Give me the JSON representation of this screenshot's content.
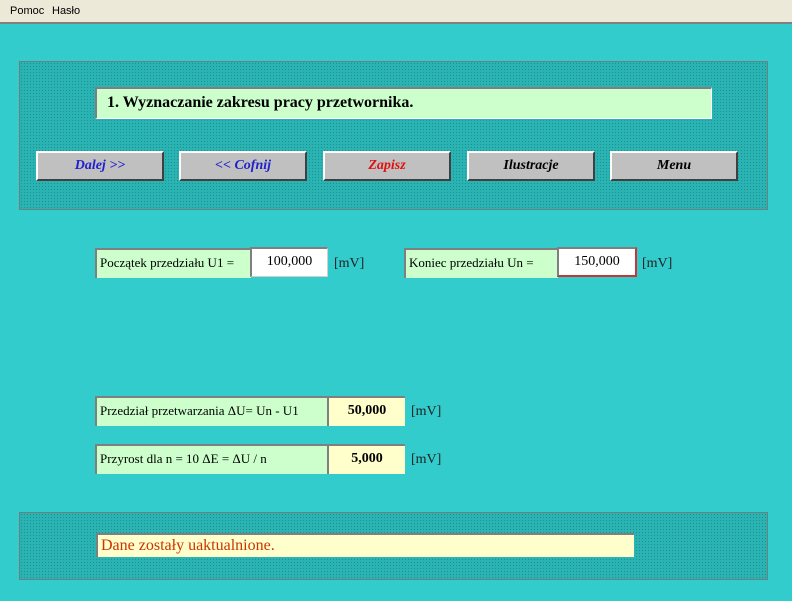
{
  "menu": {
    "help": "Pomoc",
    "password": "Hasło"
  },
  "header": {
    "title": "1. Wyznaczanie zakresu pracy przetwornika."
  },
  "buttons": {
    "next": "Dalej >>",
    "back": "<< Cofnij",
    "save": "Zapisz",
    "illustrations": "Ilustracje",
    "menu": "Menu"
  },
  "colors": {
    "next": "#1f1fcc",
    "back": "#1f1fcc",
    "save": "#e01010",
    "illustrations": "#000000",
    "menu": "#000000"
  },
  "inputs": {
    "start": {
      "label": "Początek przedziału U1 =",
      "value": "100,000",
      "unit": "[mV]"
    },
    "end": {
      "label": "Koniec przedziału Un =",
      "value": "150,000",
      "unit": "[mV]"
    }
  },
  "results": {
    "range": {
      "label": "Przedział przetwarzania ΔU= Un - U1",
      "value": "50,000",
      "unit": "[mV]"
    },
    "increment": {
      "label": "Przyrost dla n = 10 ΔE = ΔU / n",
      "value": "5,000",
      "unit": "[mV]"
    }
  },
  "status": {
    "message": "Dane zostały uaktualnione."
  }
}
